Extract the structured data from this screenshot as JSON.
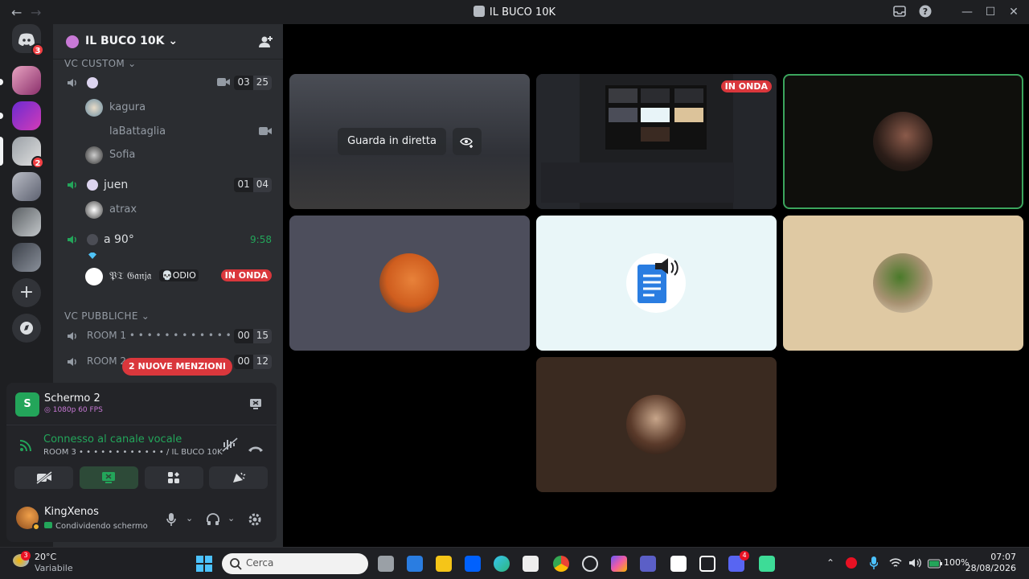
{
  "titlebar": {
    "back_icon": "←",
    "forward_icon": "→",
    "title": "IL BUCO 10K",
    "window_controls": {
      "minimize": "—",
      "maximize": "☐",
      "close": "✕"
    }
  },
  "rail": {
    "dm_badge": "3",
    "server_badge": "2"
  },
  "guild": {
    "name": "IL BUCO 10K",
    "chevron": "⌄"
  },
  "categories": {
    "custom": "VC CUSTOM ⌄",
    "public": "VC PUBBLICHE ⌄"
  },
  "custom_channels": [
    {
      "name": "",
      "count_left": "03",
      "count_right": "25"
    },
    {
      "name": "juen",
      "count_left": "01",
      "count_right": "04"
    },
    {
      "name": "a 90°",
      "timer": "9:58"
    }
  ],
  "users": {
    "kagura": "kagura",
    "labattaglia": "laBattaglia",
    "sofia": "Sofia",
    "atrax": "atrax",
    "ganja": "𝔓𝔗 𝔊𝔞𝔫𝔧𝔞",
    "ganja_tag": "💀ODIO",
    "ganja_live": "IN ONDA"
  },
  "public_channels": [
    {
      "name": "ROOM 1 • • • • • • • • • • • • • • •",
      "count_left": "00",
      "count_right": "15"
    },
    {
      "name": "ROOM 2",
      "count_left": "00",
      "count_right": "12"
    }
  ],
  "mentions_pill": "2 NUOVE MENZIONI",
  "panel": {
    "stream_title": "Schermo 2",
    "stream_quality": "1080p 60 FPS",
    "voice_status": "Connesso al canale vocale",
    "voice_location": "ROOM 3 • • • • • • • • • • • • / IL BUCO 10K",
    "username": "KingXenos",
    "user_status": "Condividendo schermo"
  },
  "stage": {
    "watch_live_label": "Guarda in diretta",
    "live_badge": "IN ONDA"
  },
  "taskbar": {
    "weather_badge": "3",
    "weather_temp": "20°C",
    "weather_desc": "Variabile",
    "search_placeholder": "Cerca",
    "discord_badge": "4",
    "battery": "100%",
    "time": "07:07",
    "date": "28/08/2026"
  },
  "colors": {
    "accent_green": "#23a55a",
    "live_red": "#da373c",
    "brand": "#5865f2"
  }
}
